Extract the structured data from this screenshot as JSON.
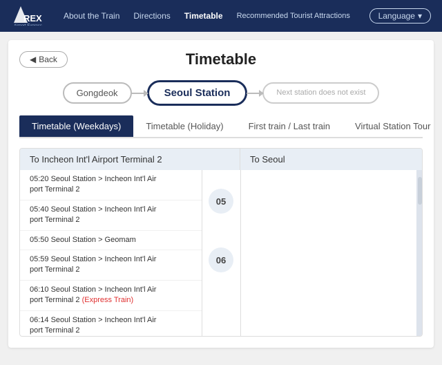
{
  "navbar": {
    "logo": "A'REX",
    "logo_sub": "Airport Express",
    "links": [
      {
        "label": "About the Train",
        "active": false
      },
      {
        "label": "Directions",
        "active": false
      },
      {
        "label": "Timetable",
        "active": true
      },
      {
        "label": "Recommended Tourist Attractions",
        "active": false
      }
    ],
    "language_button": "Language"
  },
  "page": {
    "back_label": "Back",
    "title": "Timetable"
  },
  "stations": [
    {
      "label": "Gongdeok",
      "state": "normal"
    },
    {
      "label": "Seoul Station",
      "state": "active"
    },
    {
      "label": "Next station does not exist",
      "state": "disabled"
    }
  ],
  "tabs": [
    {
      "label": "Timetable (Weekdays)",
      "active": true
    },
    {
      "label": "Timetable (Holiday)",
      "active": false
    },
    {
      "label": "First train / Last train",
      "active": false
    },
    {
      "label": "Virtual Station Tour",
      "active": false
    }
  ],
  "timetable": {
    "col_left_header": "To Incheon Int'l Airport Terminal 2",
    "col_right_header": "To Seoul",
    "hours": [
      {
        "hour": "05",
        "left_trains": [
          {
            "time": "05:20",
            "desc": "Seoul Station > Incheon Int'l Airport Terminal 2",
            "express": false
          },
          {
            "time": "05:40",
            "desc": "Seoul Station > Incheon Int'l Airport Terminal 2",
            "express": false
          },
          {
            "time": "05:50",
            "desc": "Seoul Station > Geomam",
            "express": false
          },
          {
            "time": "05:59",
            "desc": "Seoul Station > Incheon Int'l Airport Terminal 2",
            "express": false
          }
        ],
        "right_trains": []
      },
      {
        "hour": "06",
        "left_trains": [
          {
            "time": "06:10",
            "desc": "Seoul Station > Incheon Int'l Airport Terminal 2",
            "express": true,
            "express_label": "(Express Train)"
          },
          {
            "time": "06:14",
            "desc": "Seoul Station > Incheon Int'l Airport Terminal 2",
            "express": false
          }
        ],
        "right_trains": []
      }
    ]
  }
}
